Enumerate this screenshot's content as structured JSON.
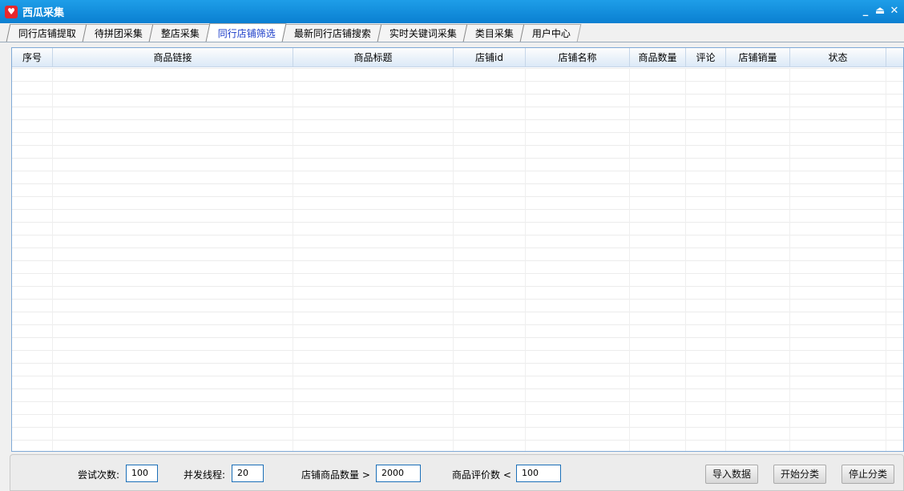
{
  "window": {
    "title": "西瓜采集",
    "controls": {
      "minimize": "_",
      "restore": "⏏",
      "close": "✕"
    }
  },
  "tabs": [
    {
      "label": "同行店铺提取",
      "active": false
    },
    {
      "label": "待拼团采集",
      "active": false
    },
    {
      "label": "整店采集",
      "active": false
    },
    {
      "label": "同行店铺筛选",
      "active": true
    },
    {
      "label": "最新同行店铺搜索",
      "active": false
    },
    {
      "label": "实时关键词采集",
      "active": false
    },
    {
      "label": "类目采集",
      "active": false
    },
    {
      "label": "用户中心",
      "active": false
    }
  ],
  "table": {
    "columns": [
      "序号",
      "商品链接",
      "商品标题",
      "店铺id",
      "店铺名称",
      "商品数量",
      "评论",
      "店铺销量",
      "状态"
    ],
    "rows": []
  },
  "controls": {
    "retry_label": "尝试次数:",
    "retry_value": "100",
    "threads_label": "并发线程:",
    "threads_value": "20",
    "shop_goods_label": "店铺商品数量 >",
    "shop_goods_value": "2000",
    "reviews_label": "商品评价数 <",
    "reviews_value": "100",
    "import_button": "导入数据",
    "start_button": "开始分类",
    "stop_button": "停止分类"
  },
  "colors": {
    "titlebar": "#0a7fd1",
    "active_tab_text": "#1a3cc8",
    "input_border": "#1b6fb8"
  }
}
